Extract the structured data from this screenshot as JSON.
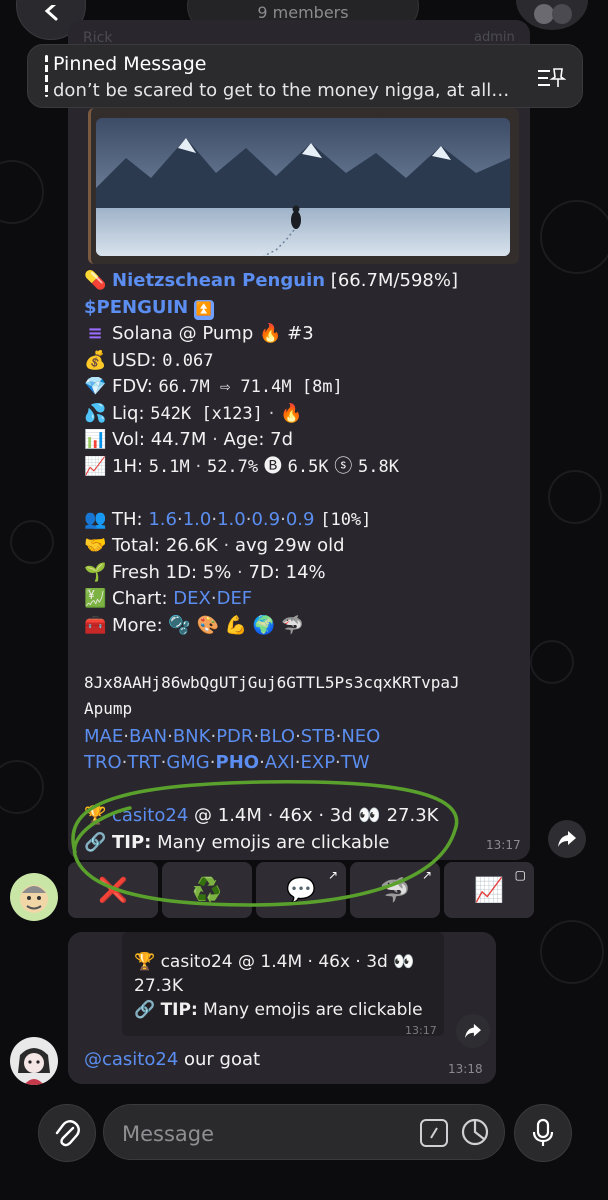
{
  "header": {
    "members": "9 members"
  },
  "pinned": {
    "title": "Pinned Message",
    "text": "don’t be scared to get to the money nigga, at all…"
  },
  "top_sender": {
    "name": "Rick",
    "role": "admin"
  },
  "message": {
    "token_line": {
      "icon": "💊",
      "name": "Nietzschean Penguin",
      "stats": "[66.7M/598%]"
    },
    "ticker": "$PENGUIN",
    "ticker_icon": "⏫",
    "chain": {
      "icon": "≡",
      "text": "Solana @ Pump",
      "fire": "🔥",
      "rank": "#3"
    },
    "usd": {
      "icon": "💰",
      "label": "USD:",
      "value": "0.067"
    },
    "fdv": {
      "icon": "💎",
      "label": "FDV:",
      "value": "66.7M ⇨ 71.4M [8m]"
    },
    "liq": {
      "icon": "💦",
      "label": "Liq:",
      "value": "542K [x123]",
      "dot": "·",
      "fire": "🔥"
    },
    "vol": {
      "icon": "📊",
      "label": "Vol:",
      "value": "44.7M",
      "age": "Age: 7d"
    },
    "h1": {
      "icon": "📈",
      "label": "1H:",
      "v1": "5.1M",
      "v2": "52.7%",
      "b_icon": "🅑",
      "b_val": "6.5K",
      "s_icon": "ⓢ",
      "s_val": "5.8K"
    },
    "th": {
      "icon": "👥",
      "label": "TH:",
      "values": [
        "1.6",
        "1.0",
        "1.0",
        "0.9",
        "0.9"
      ],
      "pct": "[10%]"
    },
    "total": {
      "icon": "🤝",
      "label": "Total:",
      "value": "26.6K",
      "avg": "avg 29w old"
    },
    "fresh": {
      "icon": "🌱",
      "label": "Fresh 1D:",
      "d1": "5%",
      "label2": "7D:",
      "d7": "14%"
    },
    "chart": {
      "icon": "💹",
      "label": "Chart:",
      "links": [
        "DEX",
        "DEF"
      ]
    },
    "more": {
      "icon": "🧰",
      "label": "More:",
      "emojis": [
        "🫧",
        "🎨",
        "💪",
        "🌍",
        "🦈"
      ]
    },
    "contract": "8Jx8AAHj86wbQgUTjGuj6GTTL5Ps3cqxKRTvpaJ",
    "contract_suffix": "Apump",
    "exchanges_row1": [
      "MAE",
      "BAN",
      "BNK",
      "PDR",
      "BLO",
      "STB",
      "NEO"
    ],
    "exchanges_row2": [
      "TRO",
      "TRT",
      "GMG",
      "PHO",
      "AXI",
      "EXP",
      "TW"
    ],
    "caller": {
      "icon": "🏆",
      "name": "casito24",
      "details": "@ 1.4M · 46x · 3d",
      "eyes": "👀",
      "views": "27.3K"
    },
    "tip": {
      "icon": "🔗",
      "label": "TIP:",
      "text": "Many emojis are clickable"
    },
    "time": "13:17"
  },
  "keyboard": [
    {
      "label": "❌",
      "corner": ""
    },
    {
      "label": "♻️",
      "corner": ""
    },
    {
      "label": "💬",
      "corner": "↗"
    },
    {
      "label": "🦈",
      "corner": "↗"
    },
    {
      "label": "📈",
      "corner": "▢"
    }
  ],
  "reply": {
    "quote_caller": "🏆 casito24 @ 1.4M · 46x · 3d 👀",
    "quote_views": "27.3K",
    "quote_tip_icon": "🔗",
    "quote_tip_label": "TIP:",
    "quote_tip_text": "Many emojis are clickable",
    "quote_time": "13:17",
    "mention": "@casito24",
    "text": "our goat",
    "time": "13:18"
  },
  "composer": {
    "placeholder": "Message"
  },
  "colors": {
    "link": "#5b8ef0",
    "annotation": "#5aa02c",
    "bubble": "#29272d"
  }
}
